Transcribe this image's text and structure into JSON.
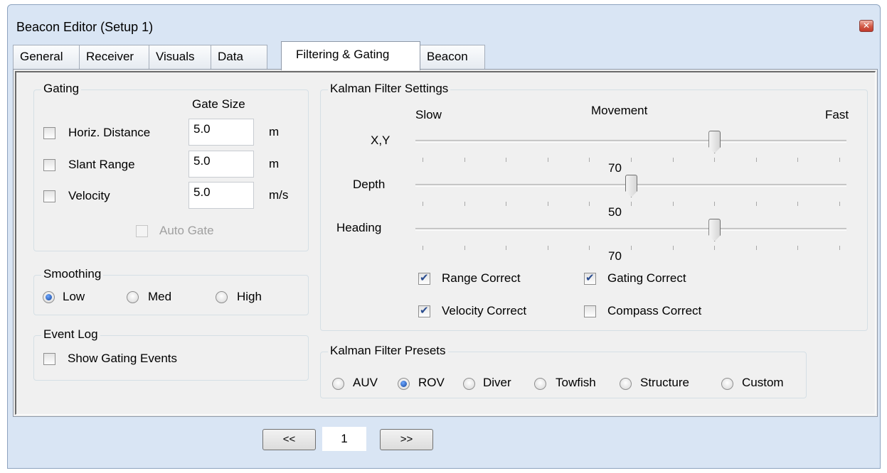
{
  "window": {
    "title": "Beacon Editor (Setup 1)",
    "close_icon": "close-icon"
  },
  "tabs": [
    {
      "label": "General"
    },
    {
      "label": "Receiver"
    },
    {
      "label": "Visuals"
    },
    {
      "label": "Data"
    },
    {
      "label": "Filtering & Gating",
      "active": true
    },
    {
      "label": "Beacon"
    }
  ],
  "gating": {
    "title": "Gating",
    "gate_size_header": "Gate Size",
    "rows": [
      {
        "label": "Horiz. Distance",
        "checked": false,
        "value": "5.0",
        "unit": "m"
      },
      {
        "label": "Slant Range",
        "checked": false,
        "value": "5.0",
        "unit": "m"
      },
      {
        "label": "Velocity",
        "checked": false,
        "value": "5.0",
        "unit": "m/s"
      }
    ],
    "auto_gate": {
      "label": "Auto Gate",
      "checked": false,
      "enabled": false
    }
  },
  "smoothing": {
    "title": "Smoothing",
    "options": [
      {
        "label": "Low",
        "selected": true
      },
      {
        "label": "Med",
        "selected": false
      },
      {
        "label": "High",
        "selected": false
      }
    ]
  },
  "event_log": {
    "title": "Event Log",
    "show_gating_events": {
      "label": "Show Gating Events",
      "checked": false
    }
  },
  "kalman": {
    "title": "Kalman Filter Settings",
    "slow_label": "Slow",
    "movement_label": "Movement",
    "fast_label": "Fast",
    "sliders": [
      {
        "label": "X,Y",
        "value": 70,
        "value_label": "70"
      },
      {
        "label": "Depth",
        "value": 50,
        "value_label": "50"
      },
      {
        "label": "Heading",
        "value": 70,
        "value_label": "70"
      }
    ],
    "slider_min": 0,
    "slider_max": 100,
    "checks": [
      {
        "label": "Range Correct",
        "checked": true
      },
      {
        "label": "Gating Correct",
        "checked": true
      },
      {
        "label": "Velocity Correct",
        "checked": true
      },
      {
        "label": "Compass Correct",
        "checked": false
      }
    ]
  },
  "presets": {
    "title": "Kalman Filter Presets",
    "options": [
      {
        "label": "AUV",
        "selected": false
      },
      {
        "label": "ROV",
        "selected": true
      },
      {
        "label": "Diver",
        "selected": false
      },
      {
        "label": "Towfish",
        "selected": false
      },
      {
        "label": "Structure",
        "selected": false
      },
      {
        "label": "Custom",
        "selected": false
      }
    ]
  },
  "pager": {
    "prev_label": "<<",
    "page": "1",
    "next_label": ">>"
  }
}
